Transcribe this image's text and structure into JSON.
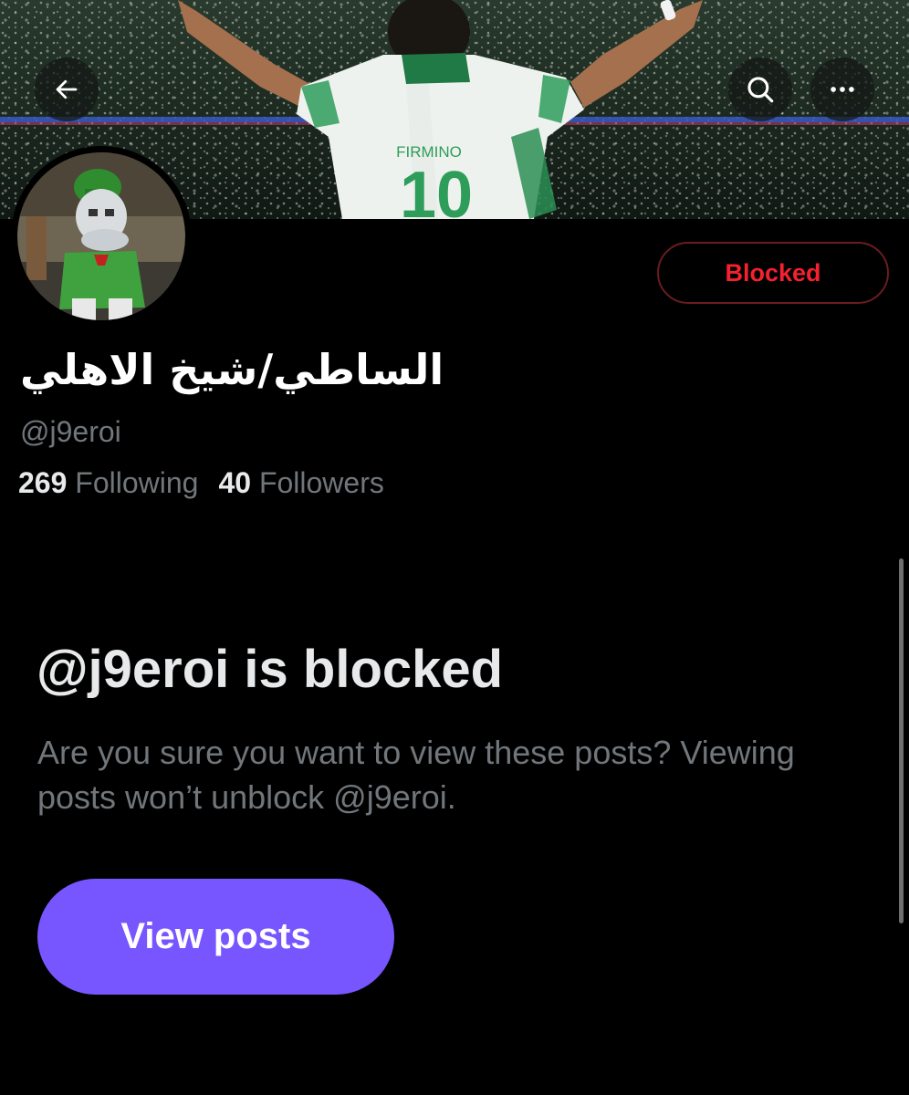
{
  "header": {
    "back_icon": "arrow-left-icon",
    "search_icon": "search-icon",
    "more_icon": "more-horizontal-icon"
  },
  "banner": {
    "jersey_name": "FIRMINO",
    "jersey_number": "10"
  },
  "profile": {
    "display_name": "الساطي/شيخ الاهلي",
    "handle": "@j9eroi",
    "following_count": "269",
    "following_label": "Following",
    "followers_count": "40",
    "followers_label": "Followers",
    "block_button_label": "Blocked"
  },
  "blocked_notice": {
    "title": "@j9eroi is blocked",
    "description": "Are you sure you want to view these posts? Viewing posts won’t unblock @j9eroi.",
    "view_button_label": "View posts"
  },
  "colors": {
    "background": "#000000",
    "blocked_red": "#f4212e",
    "accent_purple": "#7856ff",
    "muted_text": "#71767b"
  }
}
